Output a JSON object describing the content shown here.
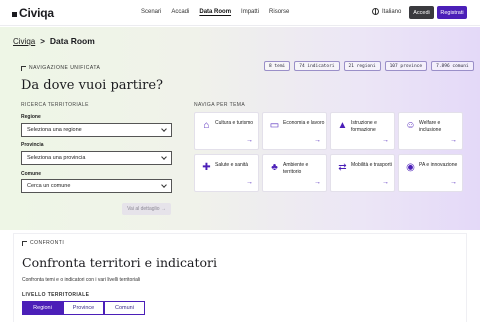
{
  "header": {
    "logo": "Civiqa",
    "nav": [
      {
        "label": "Scenari",
        "active": false
      },
      {
        "label": "Accadi",
        "active": false
      },
      {
        "label": "Data Room",
        "active": true
      },
      {
        "label": "Impatti",
        "active": false
      },
      {
        "label": "Risorse",
        "active": false
      }
    ],
    "language": "Italiano",
    "login_label": "Accedi",
    "register_label": "Registrati"
  },
  "breadcrumb": {
    "home": "Civiqa",
    "separator": ">",
    "current": "Data Room"
  },
  "hero": {
    "kicker": "NAVIGAZIONE UNIFICATA",
    "title": "Da dove vuoi partire?",
    "stats": [
      "8 temi",
      "74 indicatori",
      "21 regioni",
      "107 province",
      "7.896 comuni"
    ]
  },
  "territory": {
    "heading": "RICERCA TERRITORIALE",
    "region_label": "Regione",
    "region_value": "Seleziona una regione",
    "province_label": "Provincia",
    "province_value": "Seleziona una provincia",
    "comune_label": "Comune",
    "comune_placeholder": "Cerca un comune",
    "detail_button": "Vai al dettaglio →"
  },
  "themes": {
    "heading": "NAVIGA PER TEMA",
    "items": [
      {
        "label": "Cultura e turismo",
        "icon": "museum-icon"
      },
      {
        "label": "Economia e lavoro",
        "icon": "briefcase-icon"
      },
      {
        "label": "Istruzione e formazione",
        "icon": "graduation-cap-icon"
      },
      {
        "label": "Welfare e inclusione",
        "icon": "people-icon"
      },
      {
        "label": "Salute e sanità",
        "icon": "health-cross-icon"
      },
      {
        "label": "Ambiente e territorio",
        "icon": "leaf-icon"
      },
      {
        "label": "Mobilità e trasporti",
        "icon": "route-icon"
      },
      {
        "label": "PA e innovazione",
        "icon": "lightbulb-icon"
      }
    ]
  },
  "compare": {
    "kicker": "CONFRONTI",
    "title": "Confronta territori e indicatori",
    "description": "Confronta temi e o indicatori con i vari livelli territoriali",
    "level_label": "LIVELLO TERRITORIALE",
    "levels": [
      {
        "label": "Regioni",
        "active": true
      },
      {
        "label": "Province",
        "active": false
      },
      {
        "label": "Comuni",
        "active": false
      }
    ]
  },
  "colors": {
    "accent": "#4b1fb8",
    "login_bg": "#3a3a3e"
  }
}
